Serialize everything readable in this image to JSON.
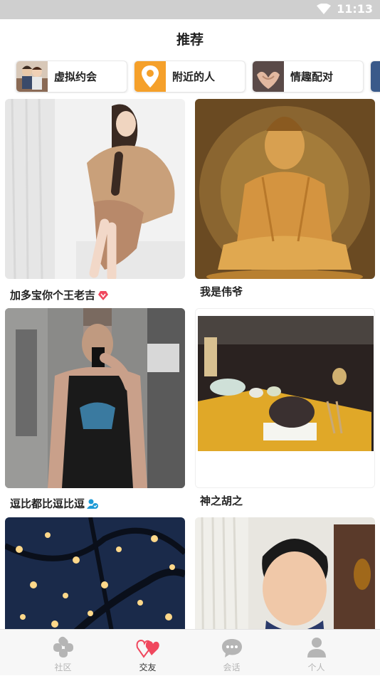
{
  "status": {
    "time": "11:13"
  },
  "header": {
    "title": "推荐"
  },
  "chips": [
    {
      "label": "虚拟约会"
    },
    {
      "label": "附近的人"
    },
    {
      "label": "情趣配对"
    }
  ],
  "cards": [
    {
      "name": "加多宝你个王老吉",
      "badge": "vip-heart-badge"
    },
    {
      "name": "我是伟爷"
    },
    {
      "name": "逗比都比逗比逗",
      "badge": "verified-user-badge"
    },
    {
      "name": "神之胡之"
    }
  ],
  "tabs": [
    {
      "label": "社区"
    },
    {
      "label": "交友"
    },
    {
      "label": "会话"
    },
    {
      "label": "个人"
    }
  ],
  "colors": {
    "accent": "#f0485e",
    "inactive": "#b5b5b5",
    "location": "#f5a02a"
  }
}
